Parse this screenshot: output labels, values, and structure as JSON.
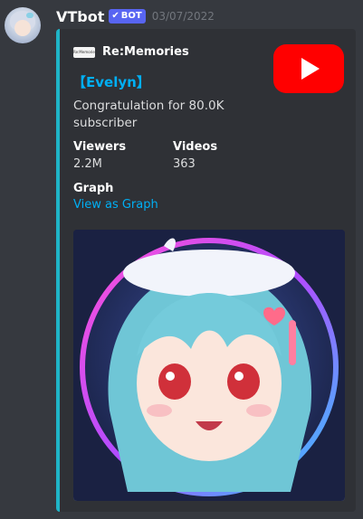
{
  "message": {
    "username": "VTbot",
    "badge": "BOT",
    "timestamp": "03/07/2022"
  },
  "embed": {
    "accent_color": "#1fb4c7",
    "author": {
      "name": "Re:Memories",
      "icon_text": "Re:Memories"
    },
    "title": "【Evelyn】",
    "description": "Congratulation for 80.0K subscriber",
    "fields": [
      {
        "name": "Viewers",
        "value": "2.2M"
      },
      {
        "name": "Videos",
        "value": "363"
      },
      {
        "name": "Graph",
        "value": "View as Graph"
      }
    ],
    "thumbnail_icon": "youtube-logo",
    "image_icon": "anime-avatar-illustration"
  }
}
